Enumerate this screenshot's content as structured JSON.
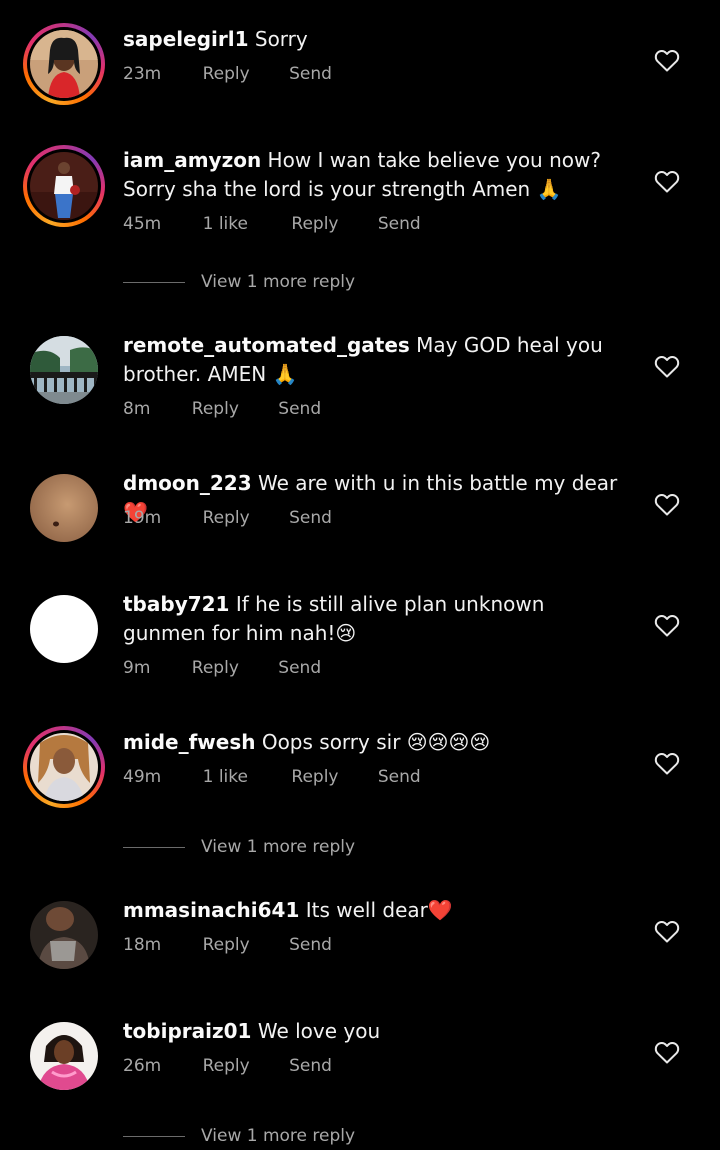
{
  "comments": [
    {
      "username": "sapelegirl1",
      "text": "Sorry",
      "time": "23m",
      "likes": "",
      "reply_label": "Reply",
      "send_label": "Send",
      "story_ring": true
    },
    {
      "username": "iam_amyzon",
      "text": "How I wan take believe you now? Sorry sha the lord is your strength Amen 🙏",
      "time": "45m",
      "likes": "1 like",
      "reply_label": "Reply",
      "send_label": "Send",
      "story_ring": true,
      "view_more": "View 1 more reply"
    },
    {
      "username": "remote_automated_gates",
      "text": "May GOD heal you brother. AMEN 🙏",
      "time": "8m",
      "likes": "",
      "reply_label": "Reply",
      "send_label": "Send",
      "story_ring": false
    },
    {
      "username": "dmoon_223",
      "text": "We are with u in this battle my dear❤️",
      "time": "19m",
      "likes": "",
      "reply_label": "Reply",
      "send_label": "Send",
      "story_ring": false
    },
    {
      "username": "tbaby721",
      "text": "If he is still alive plan unknown gunmen for him nah!😢",
      "time": "9m",
      "likes": "",
      "reply_label": "Reply",
      "send_label": "Send",
      "story_ring": false
    },
    {
      "username": "mide_fwesh",
      "text": "Oops sorry sir 😢😢😢😢",
      "time": "49m",
      "likes": "1 like",
      "reply_label": "Reply",
      "send_label": "Send",
      "story_ring": true,
      "view_more": "View 1 more reply"
    },
    {
      "username": "mmasinachi641",
      "text": "Its well dear❤️",
      "time": "18m",
      "likes": "",
      "reply_label": "Reply",
      "send_label": "Send",
      "story_ring": false
    },
    {
      "username": "tobipraiz01",
      "text": "We love you",
      "time": "26m",
      "likes": "",
      "reply_label": "Reply",
      "send_label": "Send",
      "story_ring": false,
      "view_more": "View 1 more reply"
    }
  ],
  "icons": {
    "like": "heart-outline-icon"
  },
  "colors": {
    "background": "#000000",
    "text": "#f2f2f2",
    "secondary": "#a8a8a8",
    "story_ring_start": "#f9a825",
    "story_ring_end": "#c13584"
  }
}
